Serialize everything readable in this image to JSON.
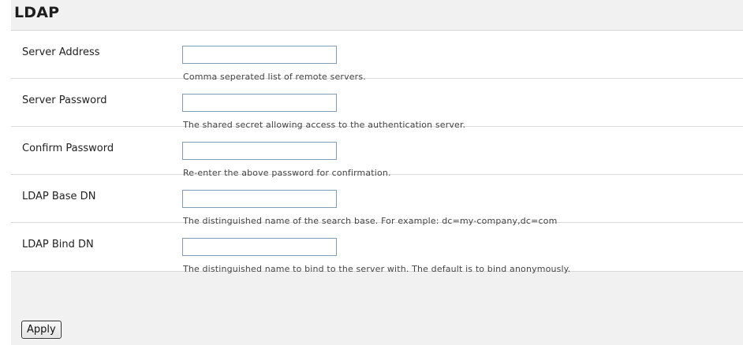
{
  "page": {
    "title": "LDAP"
  },
  "fields": [
    {
      "label": "Server Address",
      "value": "",
      "help": "Comma seperated list of remote servers."
    },
    {
      "label": "Server Password",
      "value": "",
      "help": "The shared secret allowing access to the authentication server."
    },
    {
      "label": "Confirm Password",
      "value": "",
      "help": "Re-enter the above password for confirmation."
    },
    {
      "label": "LDAP Base DN",
      "value": "",
      "help": "The distinguished name of the search base. For example: dc=my-company,dc=com"
    },
    {
      "label": "LDAP Bind DN",
      "value": "",
      "help": "The distinguished name to bind to the server with. The default is to bind anonymously."
    }
  ],
  "actions": {
    "apply_label": "Apply"
  }
}
